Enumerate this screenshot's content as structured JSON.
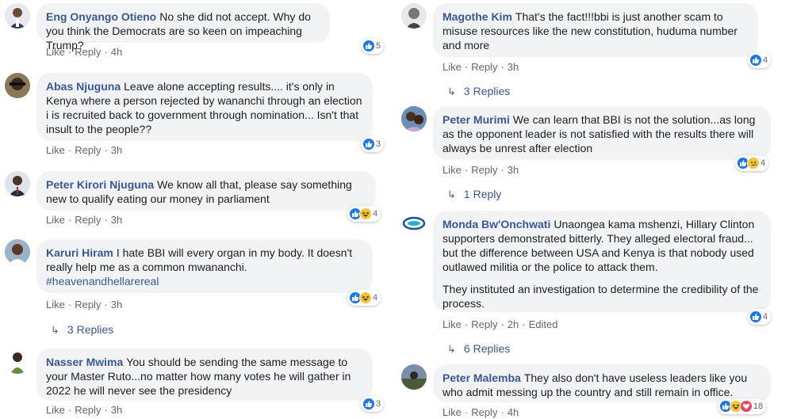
{
  "actions": {
    "like": "Like",
    "reply": "Reply",
    "sep": "·"
  },
  "left": [
    {
      "author": "Eng Onyango Otieno",
      "text": "No she did not accept. Why do you think the Democrats are so keen on impeaching Trump?",
      "time": "4h",
      "reactions": [
        "like"
      ],
      "count": "5"
    },
    {
      "author": "Abas Njuguna",
      "text": "Leave alone accepting results.... it's only in Kenya where a person rejected by wananchi through an election i is recruited back to government through nomination... Isn't that insult to the people??",
      "time": "3h",
      "reactions": [
        "like"
      ],
      "count": "3"
    },
    {
      "author": "Peter Kirori Njuguna",
      "text": "We know all that, please say something new to qualify eating our money in parliament",
      "time": "3h",
      "reactions": [
        "like",
        "haha"
      ],
      "count": "4"
    },
    {
      "author": "Karuri Hiram",
      "text": "I hate BBI will every organ in my body. It doesn't really help me as a common mwananchi.",
      "hashtag": "#heavenandhellarereal",
      "time": "3h",
      "reactions": [
        "like",
        "haha"
      ],
      "count": "4",
      "replies": "3 Replies"
    },
    {
      "author": "Nasser Mwima",
      "text": "You should be sending the same message to your Master Ruto...no matter how many votes he will gather in 2022 he will never see the presidency",
      "time": "3h",
      "reactions": [
        "like"
      ],
      "count": "3"
    }
  ],
  "right": [
    {
      "author": "Magothe Kim",
      "text": "That's the fact!!!bbi is just another scam to misuse resources like the new constitution, huduma number and more",
      "time": "3h",
      "reactions": [
        "like"
      ],
      "count": "4",
      "replies": "3 Replies"
    },
    {
      "author": "Peter Murimi",
      "text": "We can learn that BBI is not the solution...as long as the opponent leader is not satisfied with the results there will always be unrest after election",
      "time": "3h",
      "reactions": [
        "like",
        "sad"
      ],
      "count": "4",
      "replies": "1 Reply"
    },
    {
      "author": "Monda Bw'Onchwati",
      "text": "Unaongea kama mshenzi, Hillary Clinton supporters demonstrated bitterly. They alleged electoral fraud... but the difference between USA and Kenya is that nobody used outlawed militia or the police to attack them.",
      "text2": "They instituted an investigation to determine the credibility of the process.",
      "time": "2h",
      "edited": "Edited",
      "reactions": [
        "like"
      ],
      "count": "4",
      "replies": "6 Replies"
    },
    {
      "author": "Peter Malemba",
      "text": "They also don't have useless leaders like you who admit messing up the country and still remain in office.",
      "time": "4h",
      "reactions": [
        "like",
        "haha",
        "love"
      ],
      "count": "18"
    }
  ]
}
